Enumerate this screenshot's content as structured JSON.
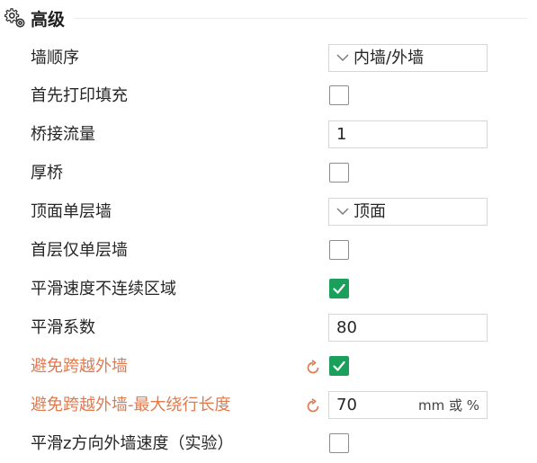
{
  "section": {
    "title": "高级",
    "icon": "gear-icon"
  },
  "colors": {
    "modified": "#e07b50",
    "check_green": "#1aa05a"
  },
  "rows": [
    {
      "label": "墙顺序",
      "control": "select",
      "value": "内墙/外墙"
    },
    {
      "label": "首先打印填充",
      "control": "checkbox",
      "checked": false
    },
    {
      "label": "桥接流量",
      "control": "text",
      "value": "1"
    },
    {
      "label": "厚桥",
      "control": "checkbox",
      "checked": false
    },
    {
      "label": "顶面单层墙",
      "control": "select",
      "value": "顶面"
    },
    {
      "label": "首层仅单层墙",
      "control": "checkbox",
      "checked": false
    },
    {
      "label": "平滑速度不连续区域",
      "control": "checkbox",
      "checked": true
    },
    {
      "label": "平滑系数",
      "control": "text",
      "value": "80"
    },
    {
      "label": "避免跨越外墙",
      "control": "checkbox",
      "checked": true,
      "modified": true
    },
    {
      "label": "避免跨越外墙-最大绕行长度",
      "control": "text",
      "value": "70",
      "unit": "mm 或 %",
      "modified": true
    },
    {
      "label": "平滑z方向外墙速度（实验）",
      "control": "checkbox",
      "checked": false
    }
  ]
}
